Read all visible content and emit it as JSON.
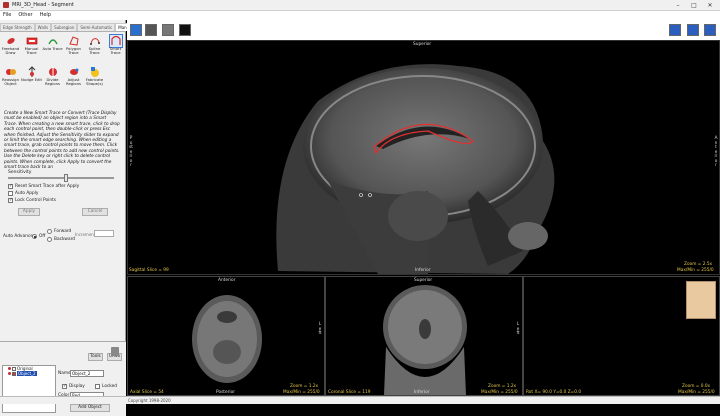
{
  "window": {
    "title": "MRI_3D_Head - Segment"
  },
  "menu": [
    "File",
    "Other",
    "Help"
  ],
  "tabs": [
    "Edge Strength",
    "Walls",
    "Subregion",
    "Semi-Automatic",
    "Manual"
  ],
  "tools_row1": [
    {
      "label": "Freehand Draw",
      "icon": "freehand-icon"
    },
    {
      "label": "Manual Trace",
      "icon": "manual-trace-icon"
    },
    {
      "label": "Auto Trace",
      "icon": "auto-trace-icon"
    },
    {
      "label": "Polygon Trace",
      "icon": "polygon-icon"
    },
    {
      "label": "Spline Trace",
      "icon": "spline-icon"
    },
    {
      "label": "Smart Trace",
      "icon": "smart-trace-icon"
    }
  ],
  "tools_row2": [
    {
      "label": "Reassign Object",
      "icon": "reassign-icon"
    },
    {
      "label": "Nudge Edit",
      "icon": "nudge-icon"
    },
    {
      "label": "Divide Regions",
      "icon": "divide-icon"
    },
    {
      "label": "Adjust Regions",
      "icon": "adjust-icon"
    },
    {
      "label": "Fabricate Shape(s)",
      "icon": "fabricate-icon"
    }
  ],
  "help_text": "Create a New Smart Trace or Convert (Trace Display must be enabled) an object region into a Smart Trace. When creating a new smart trace, click to drop each control point, then double-click or press Esc when finished. Adjust the Sensitivity slider to expand or limit the smart edge searching. When editing a smart trace, grab control points to move them. Click between the control points to add new control points. Use the Delete key or right click to delete control points. When complete, click Apply to convert the smart trace back to an",
  "sensitivity": {
    "label": "Sensitivity",
    "value": 0.55
  },
  "checkboxes": [
    {
      "label": "Reset Smart Trace after Apply",
      "checked": true
    },
    {
      "label": "Auto Apply",
      "checked": false
    },
    {
      "label": "Lock Control Points",
      "checked": true
    }
  ],
  "apply_label": "Apply",
  "cancel_label": "Cancel",
  "auto_advance": {
    "label": "Auto Advance",
    "off_label": "Off",
    "forward_label": "Forward",
    "backward_label": "Backward",
    "increment_label": "Increment"
  },
  "object_panel": {
    "tools_label": "Tools",
    "undo_label": "Undo",
    "objects": [
      {
        "name": "Original",
        "selected": false
      },
      {
        "name": "Object_2",
        "selected": true
      }
    ],
    "name_label": "Name",
    "name_value": "Object_2",
    "display_label": "Display",
    "locked_label": "Locked",
    "color_label": "Color",
    "color_value": "Red",
    "add_object_label": "Add Object"
  },
  "status": "Copyright 1998-2020",
  "sagittal": {
    "top": "Superior",
    "bottom": "Inferior",
    "left_vert": "Posterior",
    "right_vert": "Anterior",
    "slice": "Sagittal Slice = 99",
    "zoom": "Zoom = 2.5x",
    "minmax": "Max/Min = 255/0"
  },
  "axial": {
    "top": "Anterior",
    "bottom": "Posterior",
    "right_vert": "Left",
    "slice": "Axial Slice = 54",
    "zoom": "Zoom = 1.2x",
    "minmax": "Max/Min = 255/0"
  },
  "coronal": {
    "top": "Superior",
    "bottom": "Inferior",
    "right_vert": "Left",
    "slice": "Coronal Slice = 119",
    "zoom": "Zoom = 1.2x",
    "minmax": "Max/Min = 255/0"
  },
  "view3d": {
    "coords": "Rot X= 90.0 Y=0.0 Z=0.0",
    "zoom": "Zoom = 0.0x",
    "minmax": "Max/Min = 255/0"
  },
  "colors": {
    "accent": "#e5c74a",
    "trace": "#e03030"
  }
}
